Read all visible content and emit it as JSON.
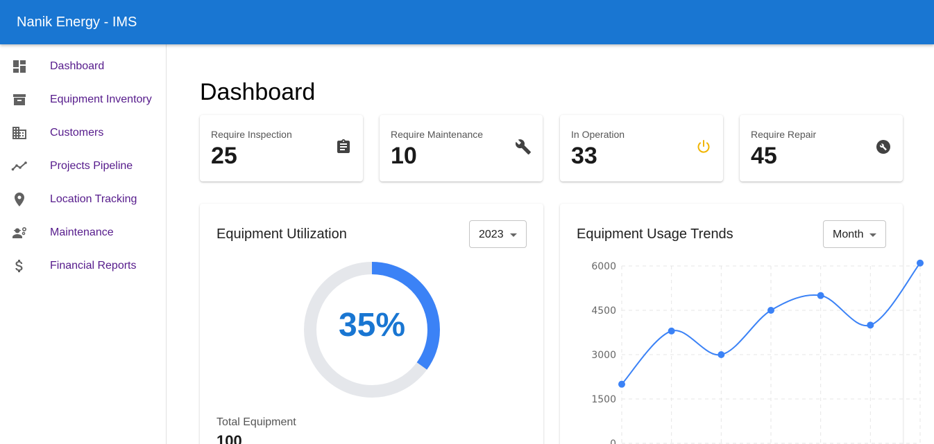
{
  "app": {
    "title": "Nanik Energy - IMS"
  },
  "sidebar": {
    "items": [
      {
        "label": "Dashboard",
        "icon": "dashboard-icon"
      },
      {
        "label": "Equipment Inventory",
        "icon": "archive-icon"
      },
      {
        "label": "Customers",
        "icon": "business-icon"
      },
      {
        "label": "Projects Pipeline",
        "icon": "timeline-icon"
      },
      {
        "label": "Location Tracking",
        "icon": "location-pin-icon"
      },
      {
        "label": "Maintenance",
        "icon": "engineering-icon"
      },
      {
        "label": "Financial Reports",
        "icon": "dollar-icon"
      }
    ]
  },
  "main": {
    "title": "Dashboard",
    "stats": [
      {
        "label": "Require Inspection",
        "value": "25",
        "icon": "clipboard-icon",
        "color": "#424242"
      },
      {
        "label": "Require Maintenance",
        "value": "10",
        "icon": "wrench-icon",
        "color": "#424242"
      },
      {
        "label": "In Operation",
        "value": "33",
        "icon": "power-icon",
        "color": "#f0b400"
      },
      {
        "label": "Require Repair",
        "value": "45",
        "icon": "build-circle-icon",
        "color": "#424242"
      }
    ],
    "utilization": {
      "title": "Equipment Utilization",
      "year": "2023",
      "percent_label": "35%",
      "percent_value": 0.35,
      "total_label": "Total Equipment",
      "total_value": "100"
    },
    "trends": {
      "title": "Equipment Usage Trends",
      "period": "Month"
    }
  },
  "colors": {
    "appbar": "#1976d2",
    "accent": "#3b82f6",
    "track": "#e5e7eb",
    "nav_link": "#551a8b",
    "warning": "#f0b400"
  },
  "chart_data": {
    "type": "line",
    "title": "Equipment Usage Trends",
    "x": [
      1,
      2,
      3,
      4,
      5,
      6,
      7
    ],
    "values": [
      2000,
      3800,
      3000,
      4500,
      5000,
      4000,
      6100
    ],
    "ylim": [
      0,
      6000
    ],
    "yticks": [
      "6000",
      "4500",
      "3000",
      "1500",
      "0"
    ],
    "grid": true,
    "curve": "smooth",
    "color": "#3b82f6"
  }
}
